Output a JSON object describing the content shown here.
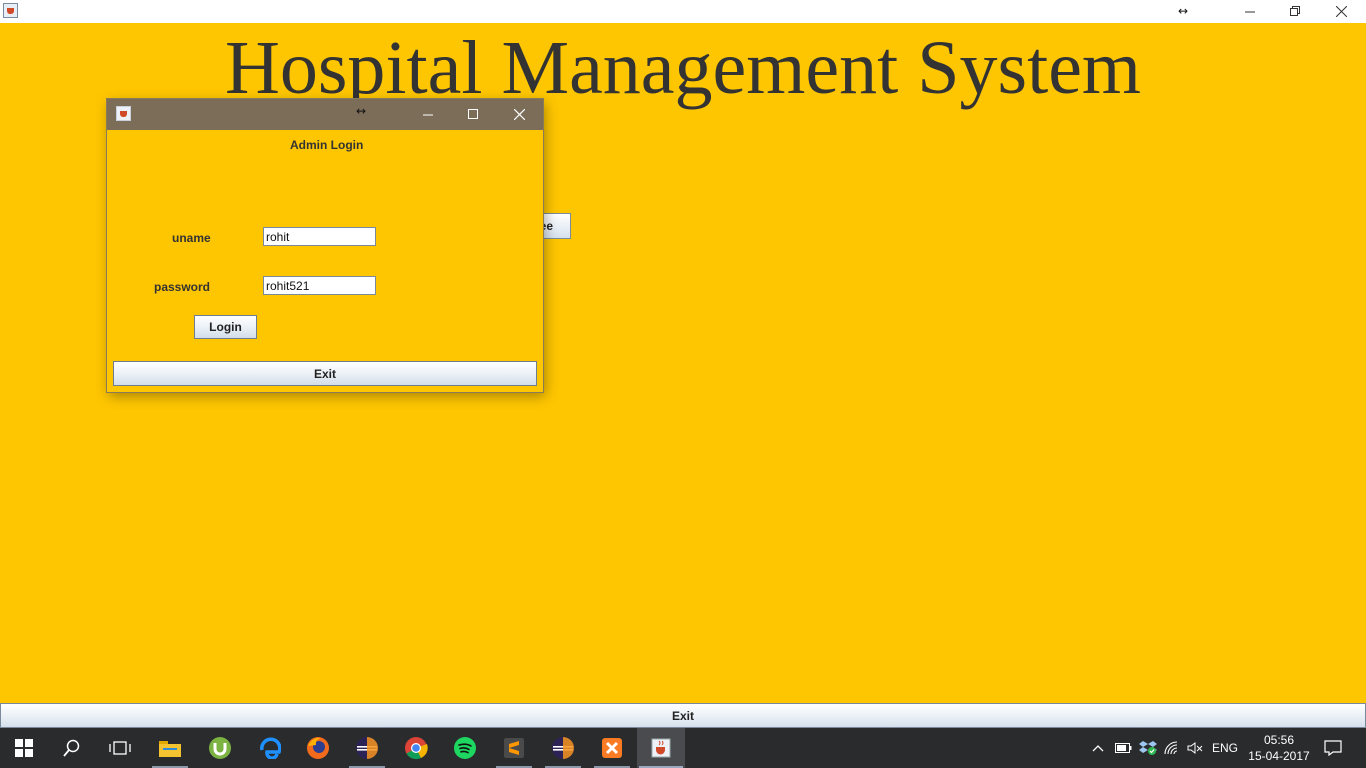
{
  "app": {
    "heading": "Hospital Management System"
  },
  "titlebar": {
    "resize_glyph": "↔",
    "minimize_glyph": "—",
    "maximize_glyph": "❐",
    "close_glyph": "✕"
  },
  "background_button": {
    "partial_label": "ee"
  },
  "main_exit": {
    "label": "Exit"
  },
  "dialog": {
    "heading": "Admin Login",
    "resize_glyph": "↔",
    "uname_label": "uname",
    "uname_value": "rohit",
    "password_label": "password",
    "password_value": "rohit521",
    "login_label": "Login",
    "exit_label": "Exit"
  },
  "taskbar": {
    "apps": [
      "file-explorer",
      "utorrent",
      "edge",
      "firefox",
      "eclipse",
      "chrome",
      "spotify",
      "sublime-text",
      "eclipse",
      "xampp",
      "java"
    ],
    "language": "ENG",
    "time": "05:56",
    "date": "15-04-2017"
  },
  "colors": {
    "background": "#fec600",
    "dialog_title": "#7c6d58",
    "taskbar": "#2a2b2d"
  }
}
